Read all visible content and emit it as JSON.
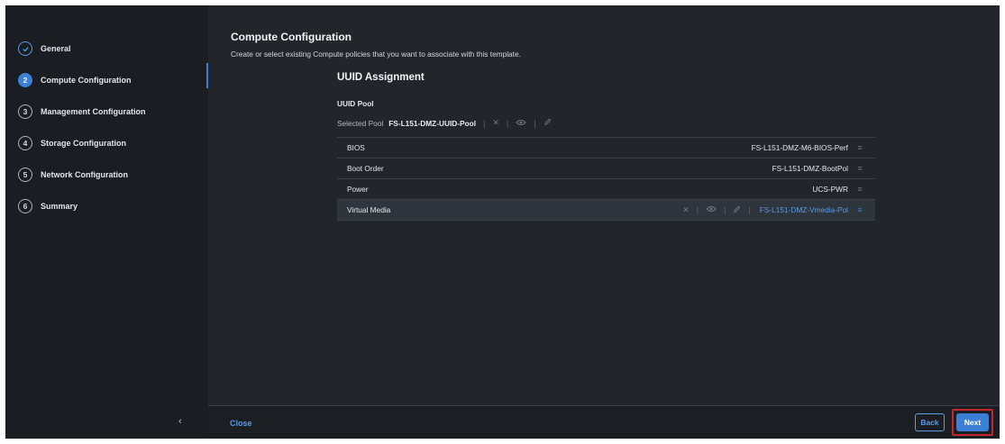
{
  "steps": [
    {
      "number": "1",
      "label": "General",
      "state": "done",
      "icon": "check-icon"
    },
    {
      "number": "2",
      "label": "Compute Configuration",
      "state": "active"
    },
    {
      "number": "3",
      "label": "Management Configuration",
      "state": "pending"
    },
    {
      "number": "4",
      "label": "Storage Configuration",
      "state": "pending"
    },
    {
      "number": "5",
      "label": "Network Configuration",
      "state": "pending"
    },
    {
      "number": "6",
      "label": "Summary",
      "state": "pending"
    }
  ],
  "sidebar": {
    "collapse_glyph": "‹"
  },
  "page": {
    "title": "Compute Configuration",
    "subtitle": "Create or select existing Compute policies that you want to associate with this template."
  },
  "uuid": {
    "section_title": "UUID Assignment",
    "pool_label": "UUID Pool",
    "selected_label": "Selected Pool",
    "selected_value": "FS-L151-DMZ-UUID-Pool"
  },
  "policies": [
    {
      "name": "BIOS",
      "value": "FS-L151-DMZ-M6-BIOS-Perf"
    },
    {
      "name": "Boot Order",
      "value": "FS-L151-DMZ-BootPol"
    },
    {
      "name": "Power",
      "value": "UCS-PWR"
    },
    {
      "name": "Virtual Media",
      "value": "FS-L151-DMZ-Vmedia-Pol"
    }
  ],
  "footer": {
    "close_label": "Close",
    "back_label": "Back",
    "next_label": "Next"
  },
  "colors": {
    "accent": "#3c7fd6",
    "highlight_border": "#c1272d",
    "background": "#1b1e22"
  }
}
